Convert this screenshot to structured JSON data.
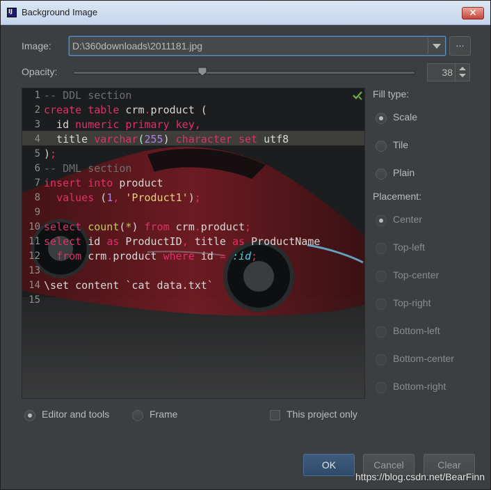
{
  "window": {
    "title": "Background Image",
    "close_glyph": "✕"
  },
  "image": {
    "label": "Image:",
    "path": "D:\\360downloads\\2011181.jpg",
    "browse_label": "..."
  },
  "opacity": {
    "label": "Opacity:",
    "value": "38",
    "slider_fraction": 0.38
  },
  "editor": {
    "line_numbers": [
      "1",
      "2",
      "3",
      "4",
      "5",
      "6",
      "7",
      "8",
      "9",
      "10",
      "11",
      "12",
      "13",
      "14",
      "15"
    ],
    "lines": [
      [
        [
          "cm",
          "-- DDL section"
        ]
      ],
      [
        [
          "kw",
          "create table "
        ],
        [
          "id",
          "crm"
        ],
        [
          "kw",
          "."
        ],
        [
          "id",
          "product ("
        ]
      ],
      [
        [
          "id",
          "  id "
        ],
        [
          "kw",
          "numeric primary key,"
        ]
      ],
      [
        [
          "id",
          "  title "
        ],
        [
          "kw",
          "varchar"
        ],
        [
          "id",
          "("
        ],
        [
          "num",
          "255"
        ],
        [
          "id",
          ") "
        ],
        [
          "kw",
          "character set "
        ],
        [
          "id",
          "utf8"
        ]
      ],
      [
        [
          "id",
          ")"
        ],
        [
          "kw",
          ";"
        ]
      ],
      [
        [
          "cm",
          "-- DML section"
        ]
      ],
      [
        [
          "kw",
          "insert into "
        ],
        [
          "id",
          "product"
        ]
      ],
      [
        [
          "id",
          "  "
        ],
        [
          "kw",
          "values "
        ],
        [
          "id",
          "("
        ],
        [
          "num",
          "1"
        ],
        [
          "kw",
          ", "
        ],
        [
          "str",
          "'Product1'"
        ],
        [
          "id",
          ")"
        ],
        [
          "kw",
          ";"
        ]
      ],
      [
        [
          "id",
          ""
        ]
      ],
      [
        [
          "kw",
          "select "
        ],
        [
          "fn",
          "count"
        ],
        [
          "id",
          "("
        ],
        [
          "fn",
          "*"
        ],
        [
          "id",
          ") "
        ],
        [
          "kw",
          "from "
        ],
        [
          "id",
          "crm"
        ],
        [
          "kw",
          "."
        ],
        [
          "id",
          "product"
        ],
        [
          "kw",
          ";"
        ]
      ],
      [
        [
          "kw",
          "select "
        ],
        [
          "id",
          "id "
        ],
        [
          "kw",
          "as "
        ],
        [
          "id",
          "ProductID"
        ],
        [
          "kw",
          ", "
        ],
        [
          "id",
          "title "
        ],
        [
          "kw",
          "as "
        ],
        [
          "id",
          "ProductName"
        ]
      ],
      [
        [
          "id",
          "  "
        ],
        [
          "kw",
          "from "
        ],
        [
          "id",
          "crm"
        ],
        [
          "kw",
          "."
        ],
        [
          "id",
          "product "
        ],
        [
          "kw",
          "where "
        ],
        [
          "id",
          "id "
        ],
        [
          "kw",
          "= "
        ],
        [
          "var",
          ":id"
        ],
        [
          "kw",
          ";"
        ]
      ],
      [
        [
          "id",
          ""
        ]
      ],
      [
        [
          "id",
          "\\set content `cat data.txt`"
        ]
      ],
      [
        [
          "id",
          ""
        ]
      ]
    ]
  },
  "fill_type": {
    "label": "Fill type:",
    "options": [
      {
        "label": "Scale",
        "selected": true
      },
      {
        "label": "Tile",
        "selected": false
      },
      {
        "label": "Plain",
        "selected": false
      }
    ]
  },
  "placement": {
    "label": "Placement:",
    "options": [
      {
        "label": "Center",
        "selected": true
      },
      {
        "label": "Top-left",
        "selected": false
      },
      {
        "label": "Top-center",
        "selected": false
      },
      {
        "label": "Top-right",
        "selected": false
      },
      {
        "label": "Bottom-left",
        "selected": false
      },
      {
        "label": "Bottom-center",
        "selected": false
      },
      {
        "label": "Bottom-right",
        "selected": false
      }
    ]
  },
  "target": {
    "editor_label": "Editor and tools",
    "frame_label": "Frame",
    "project_only_label": "This project only"
  },
  "buttons": {
    "ok": "OK",
    "cancel": "Cancel",
    "clear": "Clear"
  },
  "watermark": "https://blog.csdn.net/BearFinn",
  "colors": {
    "keyword": "#e0306a",
    "function": "#c4c860",
    "string": "#e8d17a",
    "number": "#b081e8",
    "comment": "#6d6f70",
    "accent": "#5a8ec2"
  }
}
